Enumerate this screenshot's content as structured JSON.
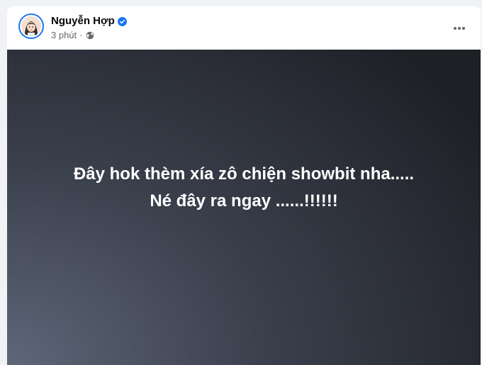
{
  "post": {
    "author": {
      "name": "Nguyễn Hợp",
      "verified": true
    },
    "meta": {
      "time": "3 phút",
      "separator": "·",
      "audience_icon": "globe-icon"
    },
    "more_icon": "more-horizontal-icon",
    "content": {
      "lines": [
        "Đây hok thèm xía zô chiện showbit nha.....",
        "Né đây ra ngay ......!!!!!!"
      ]
    }
  },
  "colors": {
    "verified": "#1877f2",
    "name": "#050505",
    "meta": "#65676b",
    "post_text": "#ffffff"
  }
}
